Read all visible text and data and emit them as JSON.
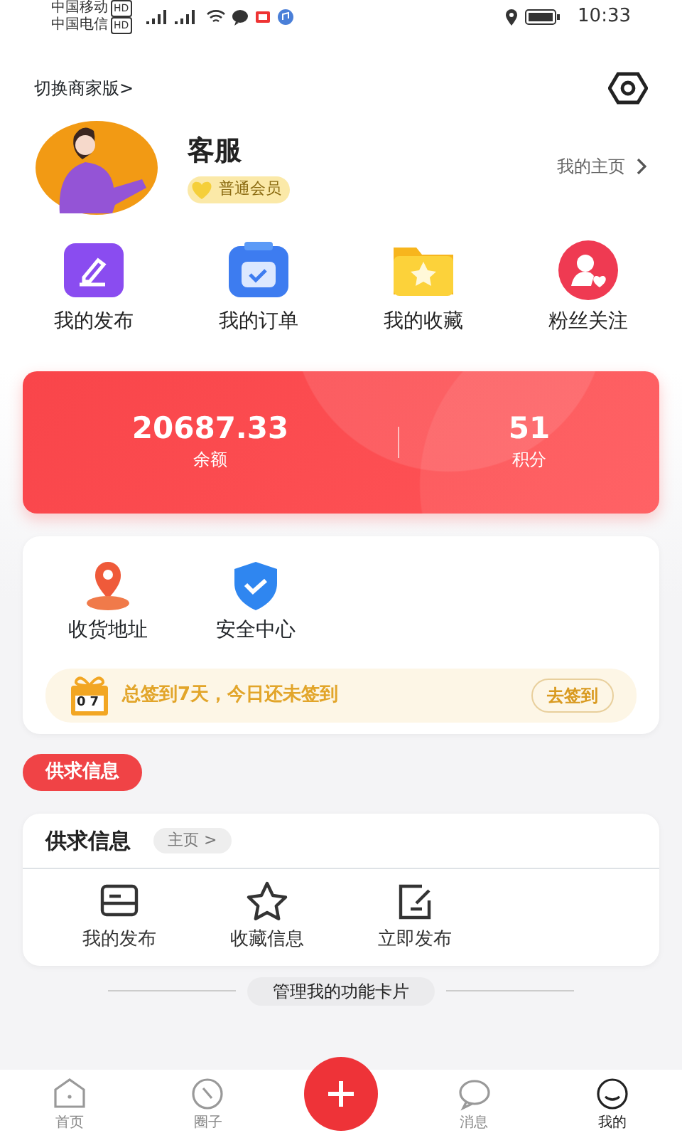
{
  "status_bar": {
    "carriers": [
      "中国移动",
      "中国电信"
    ],
    "network_tags": [
      "HD",
      "HD"
    ],
    "time": "10:33"
  },
  "header": {
    "switch_link": "切换商家版>"
  },
  "profile": {
    "name": "客服",
    "badge": "普通会员",
    "homepage_link": "我的主页"
  },
  "shortcuts": [
    {
      "label": "我的发布",
      "kind": "post"
    },
    {
      "label": "我的订单",
      "kind": "order"
    },
    {
      "label": "我的收藏",
      "kind": "favorite"
    },
    {
      "label": "粉丝关注",
      "kind": "fans"
    }
  ],
  "wallet": [
    {
      "value": "20687.33",
      "label": "余额"
    },
    {
      "value": "51",
      "label": "积分"
    }
  ],
  "services": [
    {
      "label": "收货地址",
      "kind": "location"
    },
    {
      "label": "安全中心",
      "kind": "security"
    }
  ],
  "checkin": {
    "calendar": "07",
    "text": "总签到7天，今日还未签到",
    "button": "去签到"
  },
  "section_tag": "供求信息",
  "supply_card": {
    "title": "供求信息",
    "link": "主页 >",
    "actions": [
      {
        "label": "我的发布",
        "kind": "list"
      },
      {
        "label": "收藏信息",
        "kind": "star"
      },
      {
        "label": "立即发布",
        "kind": "edit"
      }
    ]
  },
  "manage_button": "管理我的功能卡片",
  "bottom_nav": [
    {
      "label": "首页",
      "kind": "home",
      "selected": false
    },
    {
      "label": "圈子",
      "kind": "compass",
      "selected": false
    },
    {
      "kind": "add",
      "selected": false
    },
    {
      "label": "消息",
      "kind": "chat",
      "selected": false
    },
    {
      "label": "我的",
      "kind": "me",
      "selected": true
    }
  ]
}
